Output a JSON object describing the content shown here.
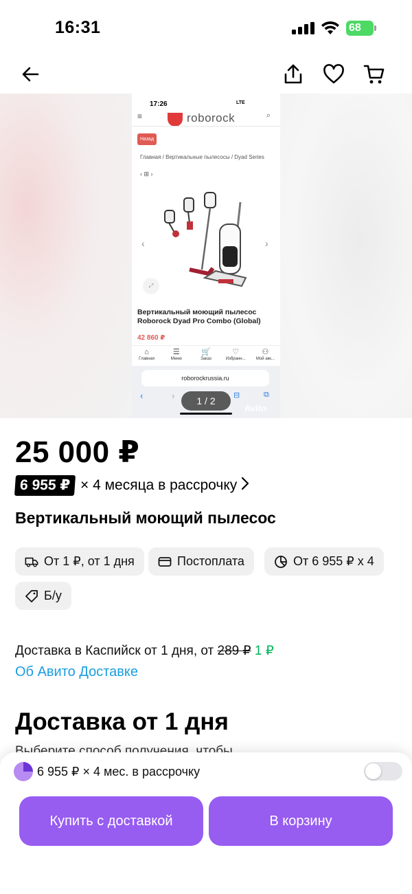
{
  "status_bar": {
    "time": "16:31",
    "battery": "68"
  },
  "gallery": {
    "counter": "1 / 2",
    "watermark": "Avito",
    "screenshot": {
      "time": "17:26",
      "network": "LTE",
      "logo": "roborock",
      "back_label": "Назад",
      "breadcrumbs": "Главная   / Вертикальные пылесосы   / Dyad Series",
      "pager": "‹  ⊞  ›",
      "product_title": "Вертикальный моющий пылесос Roborock Dyad Pro Combo (Global)",
      "product_price": "42 860 ₽",
      "tabs": [
        {
          "icon": "⌂",
          "label": "Главная"
        },
        {
          "icon": "☰",
          "label": "Меню"
        },
        {
          "icon": "🛒",
          "label": "Заказ"
        },
        {
          "icon": "♡",
          "label": "Избранн..."
        },
        {
          "icon": "⚇",
          "label": "Мой акк..."
        }
      ],
      "url": "roborockrussia.ru"
    }
  },
  "price": "25 000 ₽",
  "installment": {
    "badge": "6 955 ₽",
    "text": "× 4 месяца в рассрочку"
  },
  "title": "Вертикальный моющий пылесос",
  "chips": [
    {
      "icon": "truck-icon",
      "label": "От 1 ₽, от 1 дня"
    },
    {
      "icon": "card-icon",
      "label": "Постоплата"
    },
    {
      "icon": "pie-icon",
      "label": "От 6 955 ₽ x 4"
    },
    {
      "icon": "tag-icon",
      "label": "Б/у"
    }
  ],
  "delivery": {
    "prefix": "Доставка в Каспийск от 1 дня, от ",
    "old_price": "289 ₽",
    "new_price": "1 ₽",
    "link": "Об Авито Доставке"
  },
  "section": {
    "heading": "Доставка от 1 дня",
    "sub": "Выберите способ получения, чтобы"
  },
  "bottom": {
    "installment_text": "6 955 ₽ × 4 мес. в рассрочку",
    "buy_button": "Купить с доставкой",
    "cart_button": "В корзину"
  },
  "colors": {
    "accent": "#975cf0",
    "link": "#1a9de0",
    "green": "#02b35b"
  }
}
